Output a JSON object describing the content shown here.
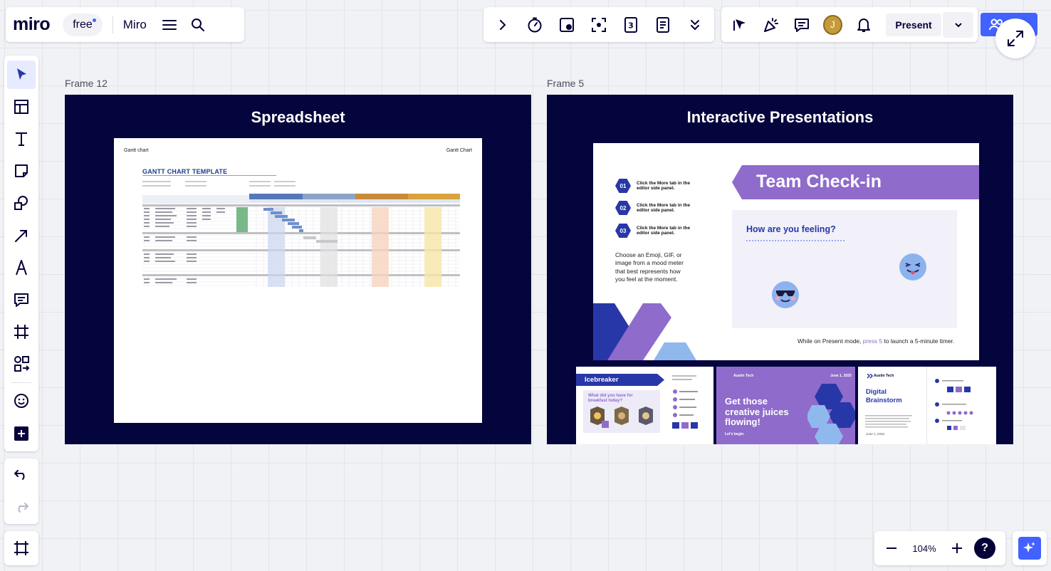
{
  "colors": {
    "brand_dark": "#050038",
    "accent": "#4262ff",
    "frame_bg": "#05053d",
    "purple": "#8f6bcc",
    "indigo": "#2837a8"
  },
  "topbar": {
    "logo": "miro",
    "plan_badge": "free",
    "board_name": "Miro",
    "menu_icon": "hamburger-menu-icon",
    "search_icon": "search-icon"
  },
  "toolbar_center": {
    "icons": [
      "chevron-right-icon",
      "timer-icon",
      "card-icon",
      "focus-frame-icon",
      "counter-icon",
      "notes-icon",
      "more-tools-icon"
    ],
    "counter_label": "3"
  },
  "collab": {
    "icons": [
      "cursor-icon",
      "celebrate-icon",
      "comment-icon"
    ],
    "avatar_initial": "J",
    "bell_icon": "bell-icon",
    "present_label": "Present"
  },
  "left_toolbar": {
    "tools": [
      "select-icon",
      "templates-icon",
      "text-icon",
      "sticky-note-icon",
      "shapes-icon",
      "connector-arrow-icon",
      "pen-icon",
      "comment-icon",
      "frame-icon",
      "diagram-icon",
      "emoji-sticker-icon",
      "more-apps-icon"
    ]
  },
  "zoom": {
    "value": "104%",
    "help_label": "?"
  },
  "frames": [
    {
      "label": "Frame 12",
      "title": "Spreadsheet",
      "sheet": {
        "header_left": "Gantt chart",
        "header_right": "Gantt Chart",
        "gantt_title": "GANTT CHART TEMPLATE"
      }
    },
    {
      "label": "Frame 5",
      "title": "Interactive Presentations",
      "slide": {
        "banner": "Team Check-in",
        "steps": [
          {
            "num": "01",
            "text": "Click the More tab in the editor side panel."
          },
          {
            "num": "02",
            "text": "Click the More tab in the editor side panel."
          },
          {
            "num": "03",
            "text": "Click the More tab in the editor side panel."
          }
        ],
        "instructions": "Choose an Emoji, GIF, or image from a mood meter that best represents how you feel at the moment.",
        "question": "How are you feeling?",
        "footer_before": "While on Present mode, ",
        "footer_key": "press 5",
        "footer_after": " to launch a 5-minute timer."
      },
      "thumbnails": {
        "icebreaker": {
          "title": "Icebreaker",
          "question": "What did you have for breakfast today?"
        },
        "juices": {
          "brand": "Austin Tech",
          "date": "June 1, 2025",
          "headline": "Get those creative juices flowing!",
          "sub": "Let's begin."
        },
        "brainstorm": {
          "brand": "Austin Tech",
          "title": "Digital Brainstorm",
          "date": "June 1, 2025"
        }
      }
    }
  ]
}
